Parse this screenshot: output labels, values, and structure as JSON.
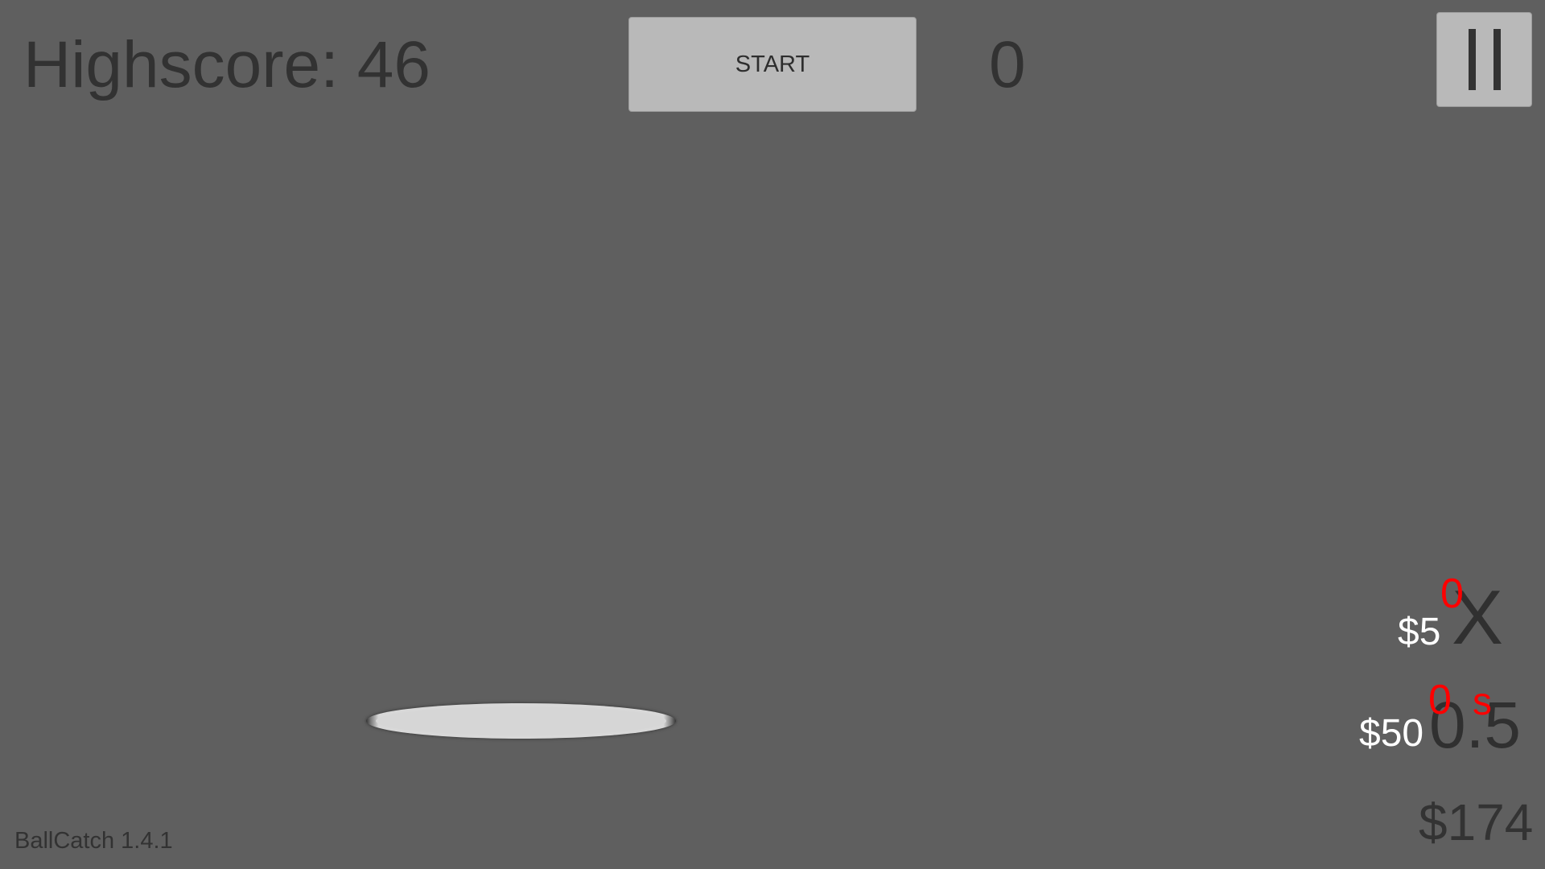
{
  "hud": {
    "highscore_text": "Highscore: 46",
    "start_label": "START",
    "score": "0",
    "pause_icon": "pause-icon"
  },
  "shop": {
    "multiplier": {
      "price": "$5",
      "level": "0",
      "symbol": "X"
    },
    "time": {
      "price": "$50",
      "level": "0",
      "unit": "s",
      "value": "0.5"
    }
  },
  "money": "$174",
  "version": "BallCatch 1.4.1",
  "colors": {
    "background": "#5f5f5f",
    "button": "#b9b9b9",
    "text_dark": "#323232",
    "price_text": "#ffffff",
    "level_text": "#ff0000",
    "paddle": "#d6d6d6"
  }
}
